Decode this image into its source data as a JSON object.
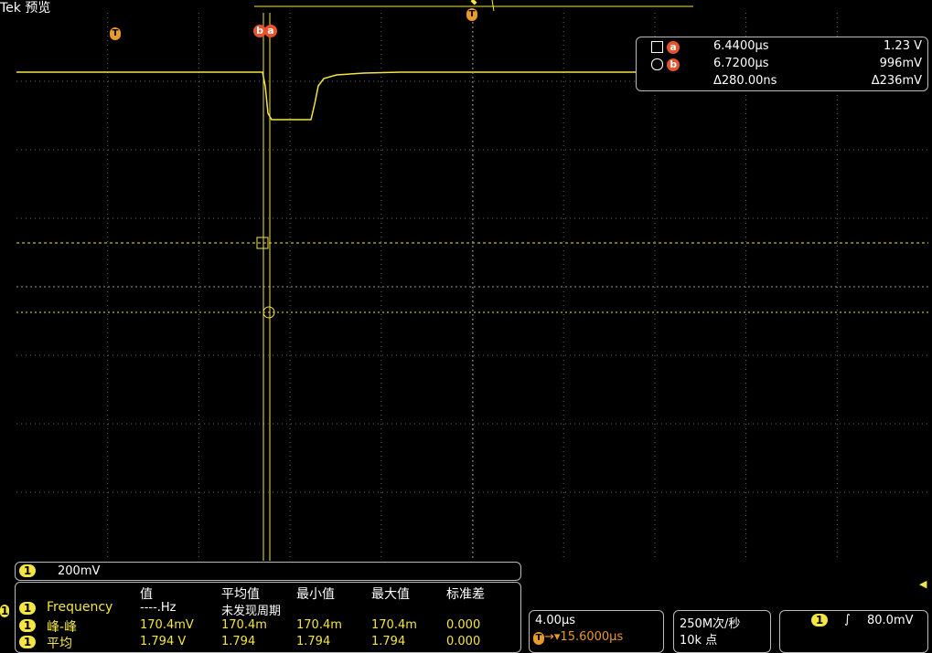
{
  "brand": "Tek",
  "mode": "预览",
  "markers": {
    "trigger_pos": "T",
    "trigger_top": "T",
    "cursor_b": "b",
    "cursor_a": "a"
  },
  "cursor": {
    "a": {
      "label": "a",
      "time": "6.4400µs",
      "value": "1.23 V"
    },
    "b": {
      "label": "b",
      "time": "6.7200µs",
      "value": "996mV"
    },
    "delta": {
      "time": "Δ280.00ns",
      "value": "Δ236mV"
    }
  },
  "channel": {
    "id": "1",
    "scale": "200mV"
  },
  "measurements": {
    "headers": [
      "值",
      "平均值",
      "最小值",
      "最大值",
      "标准差"
    ],
    "rows": [
      {
        "ch": "1",
        "name": "Frequency",
        "value": "----.Hz",
        "mean": "未发现周期",
        "min": "",
        "max": "",
        "std": ""
      },
      {
        "ch": "1",
        "name": "峰-峰",
        "value": "170.4mV",
        "mean": "170.4m",
        "min": "170.4m",
        "max": "170.4m",
        "std": "0.000"
      },
      {
        "ch": "1",
        "name": "平均",
        "value": "1.794 V",
        "mean": "1.794",
        "min": "1.794",
        "max": "1.794",
        "std": "0.000"
      }
    ]
  },
  "horizontal": {
    "scale": "4.00µs",
    "trigger_icon": "T",
    "delay": "→▾15.6000µs"
  },
  "acquisition": {
    "rate": "250M次/秒",
    "points": "10k 点"
  },
  "trigger": {
    "ch": "1",
    "slope_icon": "rising-edge-icon",
    "slope": "∫",
    "level": "80.0mV"
  },
  "colors": {
    "trace": "#f4e542",
    "cursor_badge": "#e8532a",
    "grid": "#666666"
  }
}
